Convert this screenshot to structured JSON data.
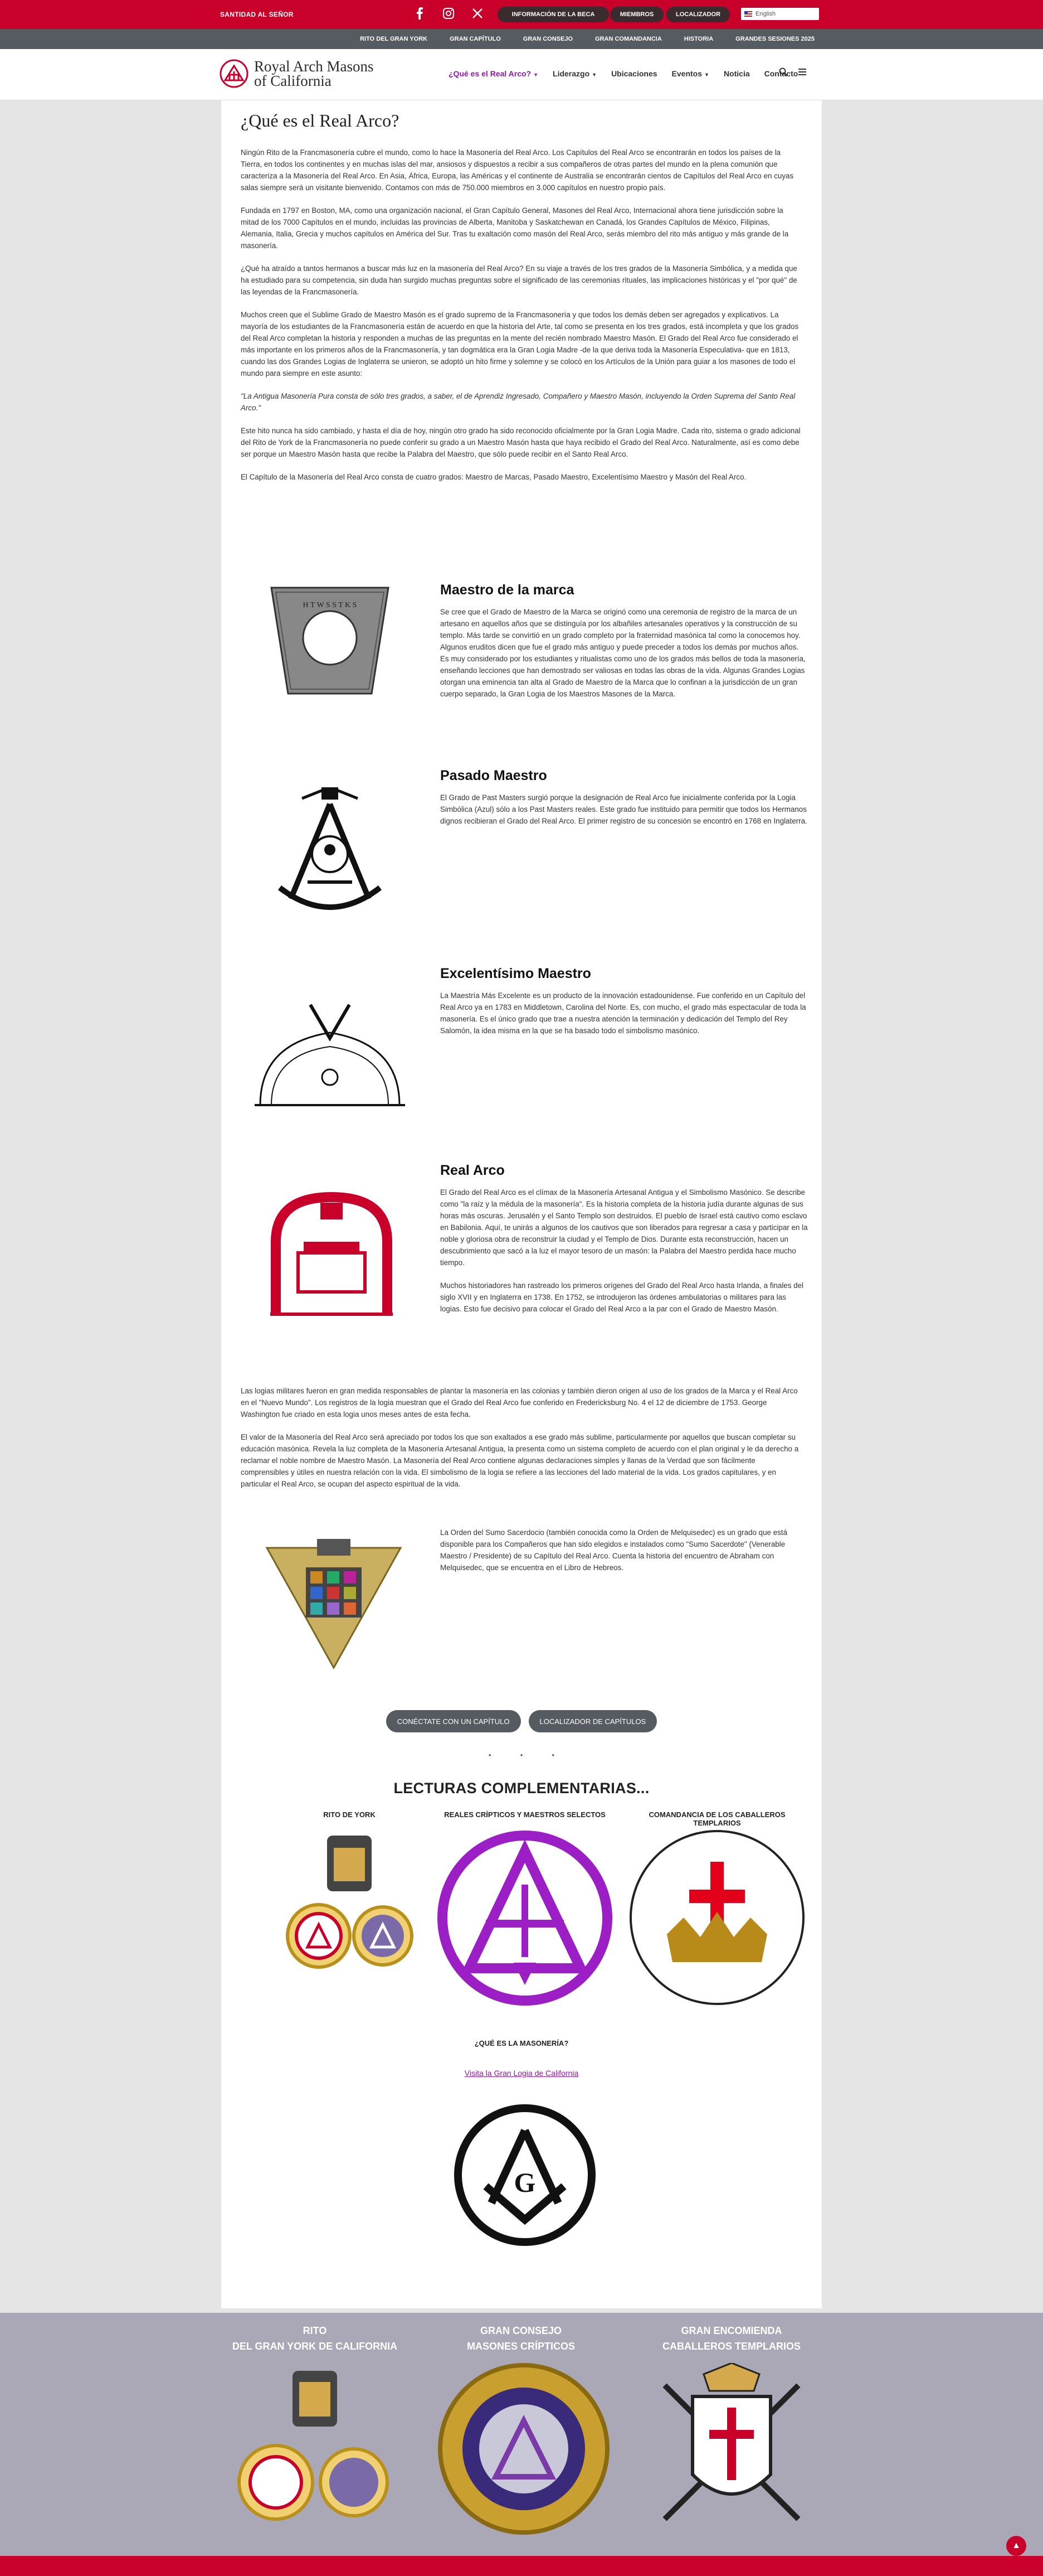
{
  "topbar": {
    "left_label": "SANTIDAD AL SEÑOR",
    "social": [
      "facebook-icon",
      "instagram-icon",
      "x-icon"
    ],
    "pills": [
      "INFORMACIÓN DE LA BECA",
      "MIEMBROS",
      "LOCALIZADOR"
    ],
    "language": "English"
  },
  "subnav": [
    "RITO DEL GRAN YORK",
    "GRAN CAPÍTULO",
    "GRAN CONSEJO",
    "GRAN COMANDANCIA",
    "HISTORIA",
    "GRANDES SESIONES 2025"
  ],
  "logo": {
    "line1": "Royal Arch Masons",
    "line2": "of California"
  },
  "menu": [
    {
      "label": "¿Qué es el Real Arco?",
      "dropdown": true,
      "active": true
    },
    {
      "label": "Liderazgo",
      "dropdown": true
    },
    {
      "label": "Ubicaciones",
      "dropdown": false
    },
    {
      "label": "Eventos",
      "dropdown": true
    },
    {
      "label": "Noticia",
      "dropdown": false
    },
    {
      "label": "Contacto",
      "dropdown": false
    }
  ],
  "page": {
    "title": "¿Qué es el Real Arco?",
    "intro": [
      "Ningún Rito de la Francmasonería cubre el mundo, como lo hace la Masonería del Real Arco. Los Capítulos del Real Arco se encontrarán en todos los países de la Tierra, en todos los continentes y en muchas islas del mar, ansiosos y dispuestos a recibir a sus compañeros de otras partes del mundo en la plena comunión que caracteriza a la Masonería del Real Arco. En Asia, África, Europa, las Américas y el continente de Australia se encontrarán cientos de Capítulos del Real Arco en cuyas salas siempre será un visitante bienvenido. Contamos con más de 750.000 miembros en 3.000 capítulos en nuestro propio país.",
      "Fundada en 1797 en Boston, MA, como una organización nacional, el Gran Capítulo General, Masones del Real Arco, Internacional ahora tiene jurisdicción sobre la mitad de los 7000 Capítulos en el mundo, incluidas las provincias de Alberta, Manitoba y Saskatchewan en Canadá, los Grandes Capítulos de México, Filipinas, Alemania, Italia, Grecia y muchos capítulos en América del Sur. Tras tu exaltación como masón del Real Arco, serás miembro del rito más antiguo y más grande de la masonería.",
      "¿Qué ha atraído a tantos hermanos a buscar más luz en la masonería del Real Arco? En su viaje a través de los tres grados de la Masonería Simbólica, y a medida que ha estudiado para su competencia, sin duda han surgido muchas preguntas sobre el significado de las ceremonias rituales, las implicaciones históricas y el \"por qué\" de las leyendas de la Francmasonería.",
      "Muchos creen que el Sublime Grado de Maestro Masón es el grado supremo de la Francmasonería y que todos los demás deben ser agregados y explicativos. La mayoría de los estudiantes de la Francmasonería están de acuerdo en que la historia del Arte, tal como se presenta en los tres grados, está incompleta y que los grados del Real Arco completan la historia y responden a muchas de las preguntas en la mente del recién nombrado Maestro Masón. El Grado del Real Arco fue considerado el más importante en los primeros años de la Francmasonería, y tan dogmática era la Gran Logia Madre -de la que deriva toda la Masonería Especulativa- que en 1813, cuando las dos Grandes Logias de Inglaterra se unieron, se adoptó un hito firme y solemne y se colocó en los Artículos de la Unión para guiar a los masones de todo el mundo para siempre en este asunto:",
      "\"La Antigua Masonería Pura consta de sólo tres grados, a saber, el de Aprendiz Ingresado, Compañero y Maestro Masón, incluyendo la Orden Suprema del Santo Real Arco.\"",
      "Este hito nunca ha sido cambiado, y hasta el día de hoy, ningún otro grado ha sido reconocido oficialmente por la Gran Logia Madre. Cada rito, sistema o grado adicional del Rito de York de la Francmasonería no puede conferir su grado a un Maestro Masón hasta que haya recibido el Grado del Real Arco. Naturalmente, así es como debe ser porque un Maestro Masón hasta que recibe la Palabra del Maestro, que sólo puede recibir en el Santo Real Arco.",
      "El Capítulo de la Masonería del Real Arco consta de cuatro grados: Maestro de Marcas, Pasado Maestro, Excelentísimo Maestro y Masón del Real Arco."
    ],
    "degrees": [
      {
        "title": "Maestro de la marca",
        "icon": "keystone-icon",
        "paragraphs": [
          "Se cree que el Grado de Maestro de la Marca se originó como una ceremonia de registro de la marca de un artesano en aquellos años que se distinguía por los albañiles artesanales operativos y la construcción de su templo. Más tarde se convirtió en un grado completo por la fraternidad masónica tal como la conocemos hoy. Algunos eruditos dicen que fue el grado más antiguo y puede preceder a todos los demás por muchos años. Es muy considerado por los estudiantes y ritualistas como uno de los grados más bellos de toda la masonería, enseñando lecciones que han demostrado ser valiosas en todas las obras de la vida. Algunas Grandes Logias otorgan una eminencia tan alta al Grado de Maestro de la Marca que lo confinan a la jurisdicción de un gran cuerpo separado, la Gran Logia de los Maestros Masones de la Marca."
        ]
      },
      {
        "title": "Pasado Maestro",
        "icon": "past-master-jewel-icon",
        "paragraphs": [
          "El Grado de Past Masters surgió porque la designación de Real Arco fue inicialmente conferida por la Logia Simbólica (Azul) sólo a los Past Masters reales. Este grado fue instituido para permitir que todos los Hermanos dignos recibieran el Grado del Real Arco. El primer registro de su concesión se encontró en 1768 en Inglaterra."
        ]
      },
      {
        "title": "Excelentísimo Maestro",
        "icon": "arch-compass-icon",
        "paragraphs": [
          "La Maestría Más Excelente es un producto de la innovación estadounidense. Fue conferido en un Capítulo del Real Arco ya en 1783 en Middletown, Carolina del Norte. Es, con mucho, el grado más espectacular de toda la masonería. Es el único grado que trae a nuestra atención la terminación y dedicación del Templo del Rey Salomón, la idea misma en la que se ha basado todo el simbolismo masónico."
        ]
      },
      {
        "title": "Real Arco",
        "icon": "royal-arch-icon",
        "paragraphs": [
          "El Grado del Real Arco es el clímax de la Masonería Artesanal Antigua y el Simbolismo Masónico. Se describe como \"la raíz y la médula de la masonería\". Es la historia completa de la historia judía durante algunas de sus horas más oscuras. Jerusalén y el Santo Templo son destruidos. El pueblo de Israel está cautivo como esclavo en Babilonia. Aquí, te unirás a algunos de los cautivos que son liberados para regresar a casa y participar en la noble y gloriosa obra de reconstruir la ciudad y el Templo de Dios. Durante esta reconstrucción, hacen un descubrimiento que sacó a la luz el mayor tesoro de un masón: la Palabra del Maestro perdida hace mucho tiempo.",
          "Muchos historiadores han rastreado los primeros orígenes del Grado del Real Arco hasta Irlanda, a finales del siglo XVII y en Inglaterra en 1738. En 1752, se introdujeron las órdenes ambulatorias o militares para las logias. Esto fue decisivo para colocar el Grado del Real Arco a la par con el Grado de Maestro Masón."
        ]
      }
    ],
    "after": [
      "Las logias militares fueron en gran medida responsables de plantar la masonería en las colonias y también dieron origen al uso de los grados de la Marca y el Real Arco en el \"Nuevo Mundo\". Los registros de la logia muestran que el Grado del Real Arco fue conferido en Fredericksburg No. 4 el 12 de diciembre de 1753. George Washington fue criado en esta logia unos meses antes de esta fecha.",
      "El valor de la Masonería del Real Arco será apreciado por todos los que son exaltados a ese grado más sublime, particularmente por aquellos que buscan completar su educación masónica. Revela la luz completa de la Masonería Artesanal Antigua, la presenta como un sistema completo de acuerdo con el plan original y le da derecho a reclamar el noble nombre de Maestro Masón. La Masonería del Real Arco contiene algunas declaraciones simples y llanas de la Verdad que son fácilmente comprensibles y útiles en nuestra relación con la vida. El simbolismo de la logia se refiere a las lecciones del lado material de la vida. Los grados capitulares, y en particular el Real Arco, se ocupan del aspecto espiritual de la vida."
    ],
    "high_priest": "La Orden del Sumo Sacerdocio (también conocida como la Orden de Melquisedec) es un grado que está disponible para los Compañeros que han sido elegidos e instalados como \"Sumo Sacerdote\" (Venerable Maestro / Presidente) de su Capítulo del Real Arco. Cuenta la historia del encuentro de Abraham con Melquisedec, que se encuentra en el Libro de Hebreos.",
    "buttons": [
      "CONÉCTATE CON UN CAPÍTULO",
      "LOCALIZADOR DE CAPÍTULOS"
    ],
    "lecturas_title": "LECTURAS COMPLEMENTARIAS...",
    "lecturas": [
      "RITO DE YORK",
      "REALES CRÍPTICOS Y MAESTROS SELECTOS",
      "COMANDANCIA DE LOS CABALLEROS TEMPLARIOS"
    ],
    "what_is": "¿QUÉ ES LA MASONERÍA?",
    "what_link": "Visita la Gran Logia de California"
  },
  "footer": [
    {
      "line1": "RITO",
      "line2": "DEL GRAN YORK DE CALIFORNIA"
    },
    {
      "line1": "GRAN CONSEJO",
      "line2": "MASONES CRÍPTICOS"
    },
    {
      "line1": "GRAN ENCOMIENDA",
      "line2": "CABALLEROS TEMPLARIOS"
    }
  ],
  "colors": {
    "brand_red": "#c8002a",
    "accent_purple": "#8e1aa0",
    "dark_gray": "#555b60",
    "footer_bg": "#aaa8b7"
  }
}
